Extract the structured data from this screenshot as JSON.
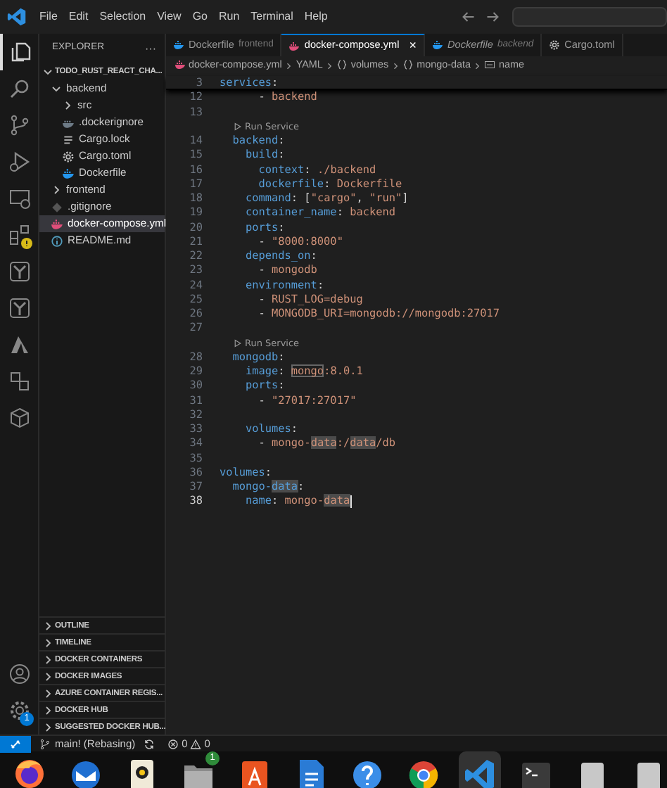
{
  "title_bar": {
    "menu": [
      "File",
      "Edit",
      "Selection",
      "View",
      "Go",
      "Run",
      "Terminal",
      "Help"
    ]
  },
  "activity_bar": {
    "items": [
      {
        "kind": "files",
        "selected": true
      },
      {
        "kind": "search",
        "selected": false
      },
      {
        "kind": "branch",
        "selected": false
      },
      {
        "kind": "debug",
        "selected": false
      },
      {
        "kind": "monitor",
        "selected": false
      },
      {
        "kind": "blocks",
        "selected": false,
        "warning": true
      },
      {
        "kind": "tree",
        "selected": false
      },
      {
        "kind": "tree",
        "selected": false
      },
      {
        "kind": "triangle",
        "selected": false
      },
      {
        "kind": "squares",
        "selected": false
      },
      {
        "kind": "cube",
        "selected": false
      }
    ],
    "settings_badge": "1"
  },
  "sidebar": {
    "title": "EXPLORER",
    "more": "···",
    "root": {
      "label": "TODO_RUST_REACT_CHA...",
      "expanded": true,
      "children": [
        {
          "label": "backend",
          "kind": "folder",
          "expanded": true,
          "selected": false,
          "children": [
            {
              "label": "src",
              "kind": "folder",
              "expanded": false,
              "selected": false
            },
            {
              "label": ".dockerignore",
              "kind": "docker-grey",
              "selected": false
            },
            {
              "label": "Cargo.lock",
              "kind": "lines",
              "selected": false
            },
            {
              "label": "Cargo.toml",
              "kind": "gear",
              "selected": false
            },
            {
              "label": "Dockerfile",
              "kind": "docker",
              "selected": false
            }
          ]
        },
        {
          "label": "frontend",
          "kind": "folder",
          "expanded": false,
          "selected": false
        },
        {
          "label": ".gitignore",
          "kind": "diamond",
          "selected": false
        },
        {
          "label": "docker-compose.yml",
          "kind": "docker-pink",
          "selected": true
        },
        {
          "label": "README.md",
          "kind": "info",
          "selected": false
        }
      ]
    },
    "panels": [
      "OUTLINE",
      "TIMELINE",
      "DOCKER CONTAINERS",
      "DOCKER IMAGES",
      "AZURE CONTAINER REGIS...",
      "DOCKER HUB",
      "SUGGESTED DOCKER HUB..."
    ]
  },
  "tabs": [
    {
      "label": "Dockerfile",
      "description": "frontend",
      "kind": "docker",
      "selected": false,
      "preview": false
    },
    {
      "label": "docker-compose.yml",
      "kind": "docker-pink",
      "selected": true,
      "preview": false,
      "close": "×"
    },
    {
      "label": "Dockerfile",
      "description": "backend",
      "kind": "docker",
      "selected": false,
      "preview": true
    },
    {
      "label": "Cargo.toml",
      "kind": "gear",
      "selected": false,
      "preview": false
    }
  ],
  "breadcrumbs": [
    {
      "label": "docker-compose.yml",
      "kind": "docker-pink"
    },
    {
      "label": "YAML",
      "kind": "none"
    },
    {
      "label": "volumes",
      "kind": "object"
    },
    {
      "label": "mongo-data",
      "kind": "object"
    },
    {
      "label": "name",
      "kind": "property"
    }
  ],
  "editor": {
    "sticky": {
      "n": "3",
      "tokens": [
        {
          "kind": "key",
          "text": "services"
        },
        {
          "kind": "punct",
          "text": ":"
        }
      ]
    },
    "lines": [
      {
        "kind": "code",
        "n": "12",
        "current": false,
        "tokens": [
          {
            "kind": "punct",
            "text": "      - "
          },
          {
            "kind": "value",
            "text": "backend"
          }
        ]
      },
      {
        "kind": "code",
        "n": "13",
        "current": false
      },
      {
        "kind": "codelens",
        "text": "Run Service"
      },
      {
        "kind": "code",
        "n": "14",
        "current": false,
        "tokens": [
          {
            "kind": "key",
            "text": "  backend"
          },
          {
            "kind": "punct",
            "text": ":"
          }
        ]
      },
      {
        "kind": "code",
        "n": "15",
        "current": false,
        "tokens": [
          {
            "kind": "key",
            "text": "    build"
          },
          {
            "kind": "punct",
            "text": ":"
          }
        ]
      },
      {
        "kind": "code",
        "n": "16",
        "current": false,
        "tokens": [
          {
            "kind": "key",
            "text": "      context"
          },
          {
            "kind": "punct",
            "text": ": "
          },
          {
            "kind": "value",
            "text": "./backend"
          }
        ]
      },
      {
        "kind": "code",
        "n": "17",
        "current": false,
        "tokens": [
          {
            "kind": "key",
            "text": "      dockerfile"
          },
          {
            "kind": "punct",
            "text": ": "
          },
          {
            "kind": "value",
            "text": "Dockerfile"
          }
        ]
      },
      {
        "kind": "code",
        "n": "18",
        "current": false,
        "tokens": [
          {
            "kind": "key",
            "text": "    command"
          },
          {
            "kind": "punct",
            "text": ": ["
          },
          {
            "kind": "value",
            "text": "\"cargo\""
          },
          {
            "kind": "punct",
            "text": ", "
          },
          {
            "kind": "value",
            "text": "\"run\""
          },
          {
            "kind": "punct",
            "text": "]"
          }
        ]
      },
      {
        "kind": "code",
        "n": "19",
        "current": false,
        "tokens": [
          {
            "kind": "key",
            "text": "    container_name"
          },
          {
            "kind": "punct",
            "text": ": "
          },
          {
            "kind": "value",
            "text": "backend"
          }
        ]
      },
      {
        "kind": "code",
        "n": "20",
        "current": false,
        "tokens": [
          {
            "kind": "key",
            "text": "    ports"
          },
          {
            "kind": "punct",
            "text": ":"
          }
        ]
      },
      {
        "kind": "code",
        "n": "21",
        "current": false,
        "tokens": [
          {
            "kind": "punct",
            "text": "      - "
          },
          {
            "kind": "value",
            "text": "\"8000:8000\""
          }
        ]
      },
      {
        "kind": "code",
        "n": "22",
        "current": false,
        "tokens": [
          {
            "kind": "key",
            "text": "    depends_on"
          },
          {
            "kind": "punct",
            "text": ":"
          }
        ]
      },
      {
        "kind": "code",
        "n": "23",
        "current": false,
        "tokens": [
          {
            "kind": "punct",
            "text": "      - "
          },
          {
            "kind": "value",
            "text": "mongodb"
          }
        ]
      },
      {
        "kind": "code",
        "n": "24",
        "current": false,
        "tokens": [
          {
            "kind": "key",
            "text": "    environment"
          },
          {
            "kind": "punct",
            "text": ":"
          }
        ]
      },
      {
        "kind": "code",
        "n": "25",
        "current": false,
        "tokens": [
          {
            "kind": "punct",
            "text": "      - "
          },
          {
            "kind": "value",
            "text": "RUST_LOG=debug"
          }
        ]
      },
      {
        "kind": "code",
        "n": "26",
        "current": false,
        "tokens": [
          {
            "kind": "punct",
            "text": "      - "
          },
          {
            "kind": "value",
            "text": "MONGODB_URI=mongodb://mongodb:27017"
          }
        ]
      },
      {
        "kind": "code",
        "n": "27",
        "current": false
      },
      {
        "kind": "codelens",
        "text": "Run Service"
      },
      {
        "kind": "code",
        "n": "28",
        "current": false,
        "tokens": [
          {
            "kind": "key",
            "text": "  mongodb"
          },
          {
            "kind": "punct",
            "text": ":"
          }
        ]
      },
      {
        "kind": "code",
        "n": "29",
        "current": false,
        "tokens": [
          {
            "kind": "key",
            "text": "    image"
          },
          {
            "kind": "punct",
            "text": ": "
          },
          {
            "kind": "mark",
            "text": "mongo"
          },
          {
            "kind": "value",
            "text": ":8.0.1"
          }
        ]
      },
      {
        "kind": "code",
        "n": "30",
        "current": false,
        "tokens": [
          {
            "kind": "key",
            "text": "    ports"
          },
          {
            "kind": "punct",
            "text": ":"
          }
        ]
      },
      {
        "kind": "code",
        "n": "31",
        "current": false,
        "tokens": [
          {
            "kind": "punct",
            "text": "      - "
          },
          {
            "kind": "value",
            "text": "\"27017:27017\""
          }
        ]
      },
      {
        "kind": "code",
        "n": "32",
        "current": false
      },
      {
        "kind": "code",
        "n": "33",
        "current": false,
        "tokens": [
          {
            "kind": "key",
            "text": "    volumes"
          },
          {
            "kind": "punct",
            "text": ":"
          }
        ]
      },
      {
        "kind": "code",
        "n": "34",
        "current": false,
        "tokens": [
          {
            "kind": "punct",
            "text": "      - "
          },
          {
            "kind": "value",
            "text": "mongo-"
          },
          {
            "kind": "highlight",
            "text": "data"
          },
          {
            "kind": "value",
            "text": ":/"
          },
          {
            "kind": "highlight",
            "text": "data"
          },
          {
            "kind": "value",
            "text": "/db"
          }
        ]
      },
      {
        "kind": "code",
        "n": "35",
        "current": false
      },
      {
        "kind": "code",
        "n": "36",
        "current": false,
        "tokens": [
          {
            "kind": "key",
            "text": "volumes"
          },
          {
            "kind": "punct",
            "text": ":"
          }
        ]
      },
      {
        "kind": "code",
        "n": "37",
        "current": false,
        "tokens": [
          {
            "kind": "key",
            "text": "  mongo-"
          },
          {
            "kind": "keyhighlight",
            "text": "data"
          },
          {
            "kind": "punct",
            "text": ":"
          }
        ]
      },
      {
        "kind": "code",
        "n": "38",
        "current": true,
        "tokens": [
          {
            "kind": "key",
            "text": "    name"
          },
          {
            "kind": "punct",
            "text": ": "
          },
          {
            "kind": "value",
            "text": "mongo-"
          },
          {
            "kind": "highlight",
            "text": "data"
          }
        ]
      }
    ]
  },
  "status_bar": {
    "branch": "main! (Rebasing)",
    "errors": "0",
    "warnings": "0"
  },
  "dock": [
    {
      "kind": "firefox",
      "active": false
    },
    {
      "kind": "mail",
      "active": false
    },
    {
      "kind": "speaker",
      "active": false
    },
    {
      "kind": "files",
      "active": false,
      "badge": "1"
    },
    {
      "kind": "store",
      "active": false
    },
    {
      "kind": "writer",
      "active": false
    },
    {
      "kind": "help",
      "active": false
    },
    {
      "kind": "chrome",
      "active": false
    },
    {
      "kind": "code",
      "active": true
    },
    {
      "kind": "terminal",
      "active": false
    },
    {
      "kind": "drive",
      "active": false
    },
    {
      "kind": "drive",
      "active": false
    }
  ]
}
